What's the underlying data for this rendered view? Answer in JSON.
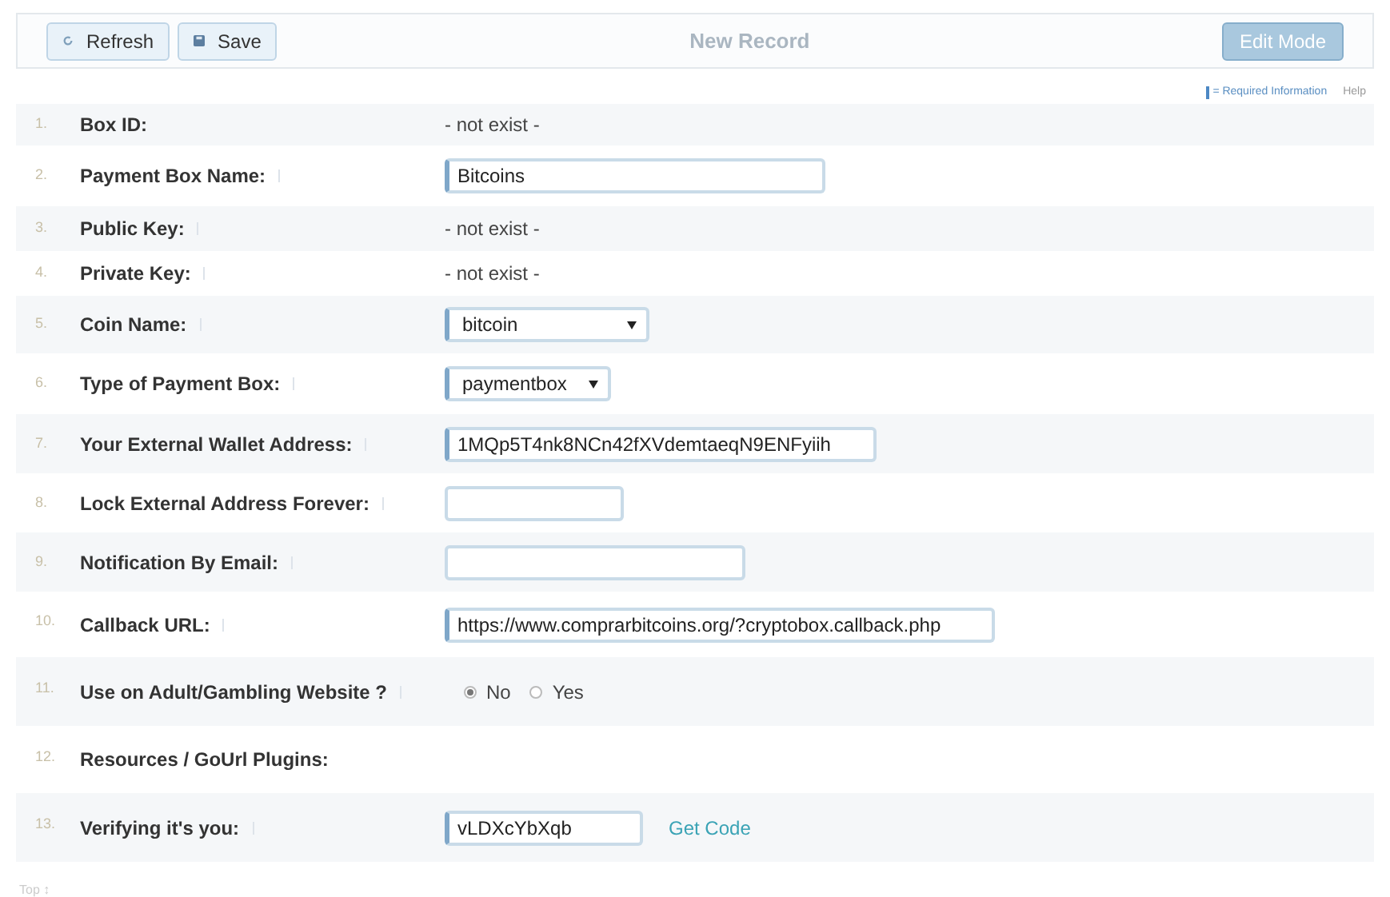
{
  "toolbar": {
    "buttons": [
      {
        "label": "Refresh"
      },
      {
        "label": "Save"
      }
    ],
    "title": "New Record",
    "mode_button": "Edit Mode"
  },
  "legend": {
    "required": "= Required Information",
    "help": "Help"
  },
  "rows": [
    {
      "number": "1.",
      "label": "Box ID:",
      "info": false,
      "kind": "text",
      "value": "- not exist -"
    },
    {
      "number": "2.",
      "label": "Payment Box Name:",
      "info": true,
      "kind": "input",
      "required": true,
      "value": "Bitcoins"
    },
    {
      "number": "3.",
      "label": "Public Key:",
      "info": true,
      "kind": "text",
      "value": "- not exist -"
    },
    {
      "number": "4.",
      "label": "Private Key:",
      "info": true,
      "kind": "text",
      "value": "- not exist -"
    },
    {
      "number": "5.",
      "label": "Coin Name:",
      "info": true,
      "kind": "select",
      "required": true,
      "value": "bitcoin"
    },
    {
      "number": "6.",
      "label": "Type of Payment Box:",
      "info": true,
      "kind": "select",
      "required": true,
      "value": "paymentbox"
    },
    {
      "number": "7.",
      "label": "Your External Wallet Address:",
      "info": true,
      "kind": "input",
      "required": true,
      "value": "1MQp5T4nk8NCn42fXVdemtaeqN9ENFyiih"
    },
    {
      "number": "8.",
      "label": "Lock External Address Forever:",
      "info": true,
      "kind": "input",
      "required": false
    },
    {
      "number": "9.",
      "label": "Notification By Email:",
      "info": true,
      "kind": "input",
      "required": false
    },
    {
      "number": "10.",
      "label": "Callback URL:",
      "info": true,
      "kind": "input",
      "required": true,
      "value": "https://www.comprarbitcoins.org/?cryptobox.callback.php"
    },
    {
      "number": "11.",
      "label": "Use on Adult/Gambling Website ?",
      "info": true,
      "kind": "radio",
      "options": [
        {
          "label": "No",
          "selected": true
        },
        {
          "label": "Yes",
          "selected": false
        }
      ]
    },
    {
      "number": "12.",
      "label": "Resources / GoUrl Plugins:",
      "info": false,
      "kind": "empty"
    },
    {
      "number": "13.",
      "label": "Verifying it's you:",
      "info": true,
      "kind": "input",
      "required": true,
      "value": "vLDXcYbXqb",
      "link": "Get Code"
    }
  ],
  "footer": "Top ↕"
}
